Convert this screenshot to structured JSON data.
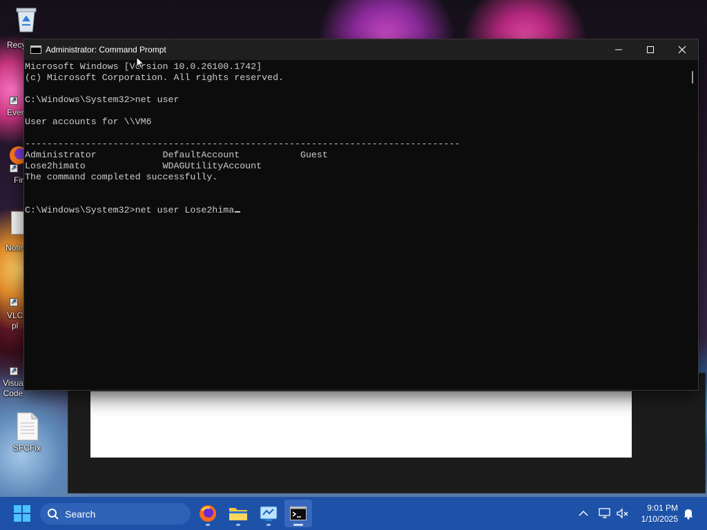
{
  "desktop": {
    "icons": [
      {
        "label": "Recy"
      },
      {
        "label": "Ever"
      },
      {
        "label": "Fir"
      },
      {
        "label": "Note"
      },
      {
        "label": "VLC\npl"
      },
      {
        "label": "Visua\nCode"
      },
      {
        "label": "SFCFix"
      }
    ]
  },
  "window": {
    "title": "Administrator: Command Prompt",
    "controls": {
      "minimize": "minimize",
      "maximize": "maximize",
      "close": "close"
    }
  },
  "console": {
    "lines": [
      "Microsoft Windows [Version 10.0.26100.1742]",
      "(c) Microsoft Corporation. All rights reserved.",
      "",
      "C:\\Windows\\System32>net user",
      "",
      "User accounts for \\\\VM6",
      "",
      "-------------------------------------------------------------------------------",
      "Administrator            DefaultAccount           Guest",
      "Lose2himato              WDAGUtilityAccount",
      "The command completed successfully.",
      "",
      ""
    ],
    "prompt": "C:\\Windows\\System32>",
    "current_input": "net user Lose2hima"
  },
  "taskbar": {
    "search_label": "Search",
    "apps": [
      {
        "name": "firefox",
        "icon": "firefox-icon"
      },
      {
        "name": "file-explorer",
        "icon": "folder-icon"
      },
      {
        "name": "control-panel",
        "icon": "control-panel-icon"
      },
      {
        "name": "command-prompt",
        "icon": "cmd-icon",
        "active": true
      }
    ],
    "clock": {
      "time": "9:01 PM",
      "date": "1/10/2025"
    }
  },
  "colors": {
    "taskbar": "#1d52a8",
    "console_bg": "#0c0c0c",
    "console_text": "#cccccc",
    "titlebar": "#1f1f1f"
  }
}
